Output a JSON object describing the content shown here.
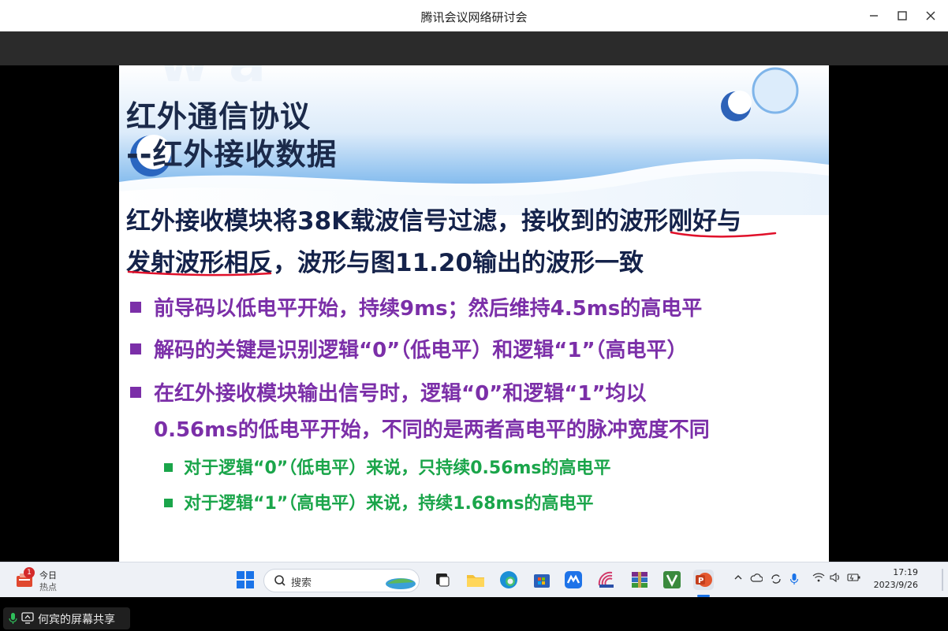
{
  "window": {
    "title": "腾讯会议网络研讨会",
    "minimize_icon": "minimize-icon",
    "maximize_icon": "maximize-icon",
    "close_icon": "close-icon"
  },
  "slide": {
    "title_line1": "红外通信协议",
    "title_line2": "--红外接收数据",
    "paragraph_line1": "红外接收模块将38K载波信号过滤，接收到的波形刚好与",
    "paragraph_line2": "发射波形相反，波形与图11.20输出的波形一致",
    "bullets": [
      "前导码以低电平开始，持续9ms；然后维持4.5ms的高电平",
      "解码的关键是识别逻辑“0”（低电平）和逻辑“1”（高电平）",
      "在红外接收模块输出信号时，逻辑“0”和逻辑“1”均以"
    ],
    "bullet3_continued": "0.56ms的低电平开始，不同的是两者高电平的脉冲宽度不同",
    "sub_bullets": [
      "对于逻辑“0”（低电平）来说，只持续0.56ms的高电平",
      "对于逻辑“1”（高电平）来说，持续1.68ms的高电平"
    ],
    "colors": {
      "title": "#1b2a4a",
      "paragraph": "#14224a",
      "bullet": "#7b2fa8",
      "sub_bullet": "#1aa54a",
      "annotation_ink": "#e0102a"
    }
  },
  "taskbar": {
    "weather_badge": "1",
    "weather_line1": "今日",
    "weather_line2": "热点",
    "search_label": "搜索",
    "clock_time": "17:19",
    "clock_date": "2023/9/26"
  },
  "share": {
    "label": "何宾的屏幕共享"
  }
}
